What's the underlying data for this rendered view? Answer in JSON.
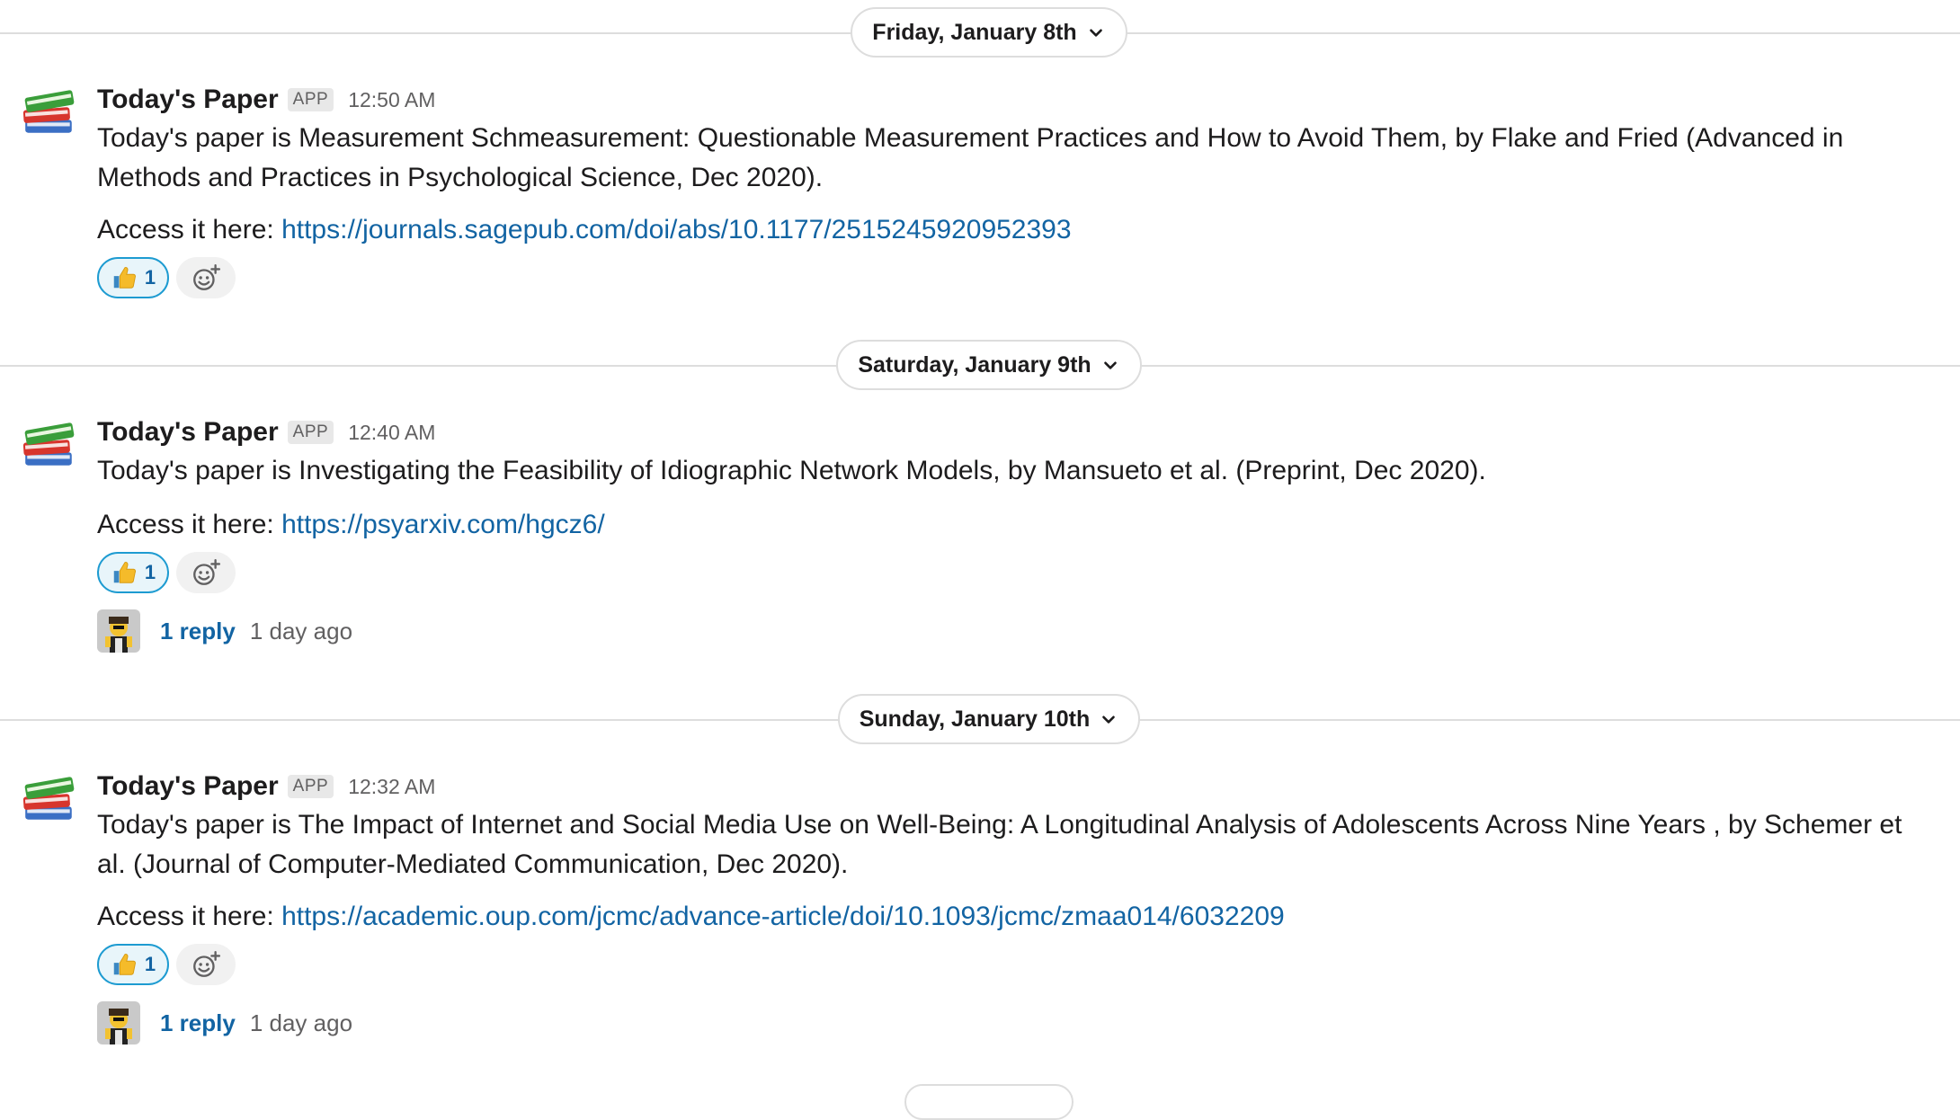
{
  "colors": {
    "link": "#1264a3",
    "reaction_border": "#1d9bd1",
    "reaction_bg": "#e8f5fa",
    "divider": "#dddddd"
  },
  "date_dividers": [
    {
      "label": "Friday, January 8th",
      "icon": "chevron-down-icon"
    },
    {
      "label": "Saturday, January 9th",
      "icon": "chevron-down-icon"
    },
    {
      "label": "Sunday, January 10th",
      "icon": "chevron-down-icon"
    }
  ],
  "messages": [
    {
      "avatar_icon": "books-icon",
      "sender": "Today's Paper",
      "badge": "APP",
      "time": "12:50 AM",
      "text": "Today's paper is Measurement Schmeasurement: Questionable Measurement Practices and How to Avoid Them, by Flake and Fried (Advanced in Methods and Practices in Psychological Science, Dec 2020).",
      "access_prefix": "Access it here: ",
      "link": "https://journals.sagepub.com/doi/abs/10.1177/2515245920952393",
      "reaction": {
        "emoji": "thumbs-up-icon",
        "count": "1"
      }
    },
    {
      "avatar_icon": "books-icon",
      "sender": "Today's Paper",
      "badge": "APP",
      "time": "12:40 AM",
      "text": "Today's paper is Investigating the Feasibility of Idiographic Network Models, by Mansueto et al.  (Preprint, Dec 2020).",
      "access_prefix": "Access it here: ",
      "link": "https://psyarxiv.com/hgcz6/",
      "reaction": {
        "emoji": "thumbs-up-icon",
        "count": "1"
      },
      "thread": {
        "reply_count": "1 reply",
        "last_reply": "1 day ago"
      }
    },
    {
      "avatar_icon": "books-icon",
      "sender": "Today's Paper",
      "badge": "APP",
      "time": "12:32 AM",
      "text": "Today's paper is The Impact of Internet and Social Media Use on Well-Being: A Longitudinal Analysis of Adolescents Across Nine Years , by Schemer et al. (Journal of Computer-Mediated Communication, Dec 2020).",
      "access_prefix": "Access it here: ",
      "link": "https://academic.oup.com/jcmc/advance-article/doi/10.1093/jcmc/zmaa014/6032209",
      "reaction": {
        "emoji": "thumbs-up-icon",
        "count": "1"
      },
      "thread": {
        "reply_count": "1 reply",
        "last_reply": "1 day ago"
      }
    }
  ]
}
